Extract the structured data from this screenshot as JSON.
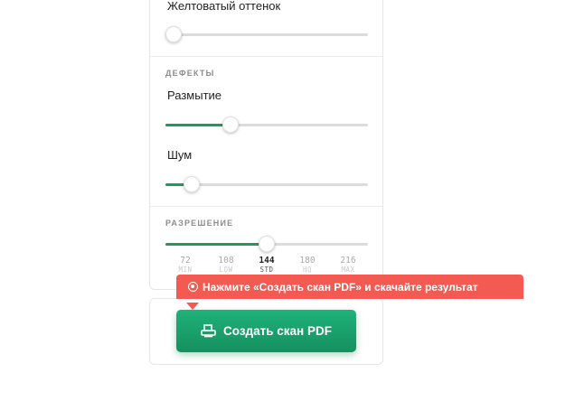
{
  "color": {
    "label": "Желтоватый оттенок",
    "yellow_tint_value": 0.04
  },
  "defects": {
    "title": "ДЕФЕКТЫ",
    "blur_label": "Размытие",
    "blur_value": 0.32,
    "noise_label": "Шум",
    "noise_value": 0.13
  },
  "resolution": {
    "title": "РАЗРЕШЕНИЕ",
    "value": 144,
    "ticks": [
      {
        "value": "72",
        "sub": "MIN"
      },
      {
        "value": "108",
        "sub": "LOW"
      },
      {
        "value": "144",
        "sub": "STD"
      },
      {
        "value": "180",
        "sub": "HQ"
      },
      {
        "value": "216",
        "sub": "MAX"
      }
    ]
  },
  "hint": {
    "text": "Нажмите «Создать скан PDF» и скачайте результат",
    "icon": "target-icon"
  },
  "action": {
    "button_label": "Создать скан PDF",
    "icon": "printer-icon"
  },
  "colors": {
    "accent": "#1f9a57",
    "button": "#15905f",
    "hint": "#f25a52"
  }
}
